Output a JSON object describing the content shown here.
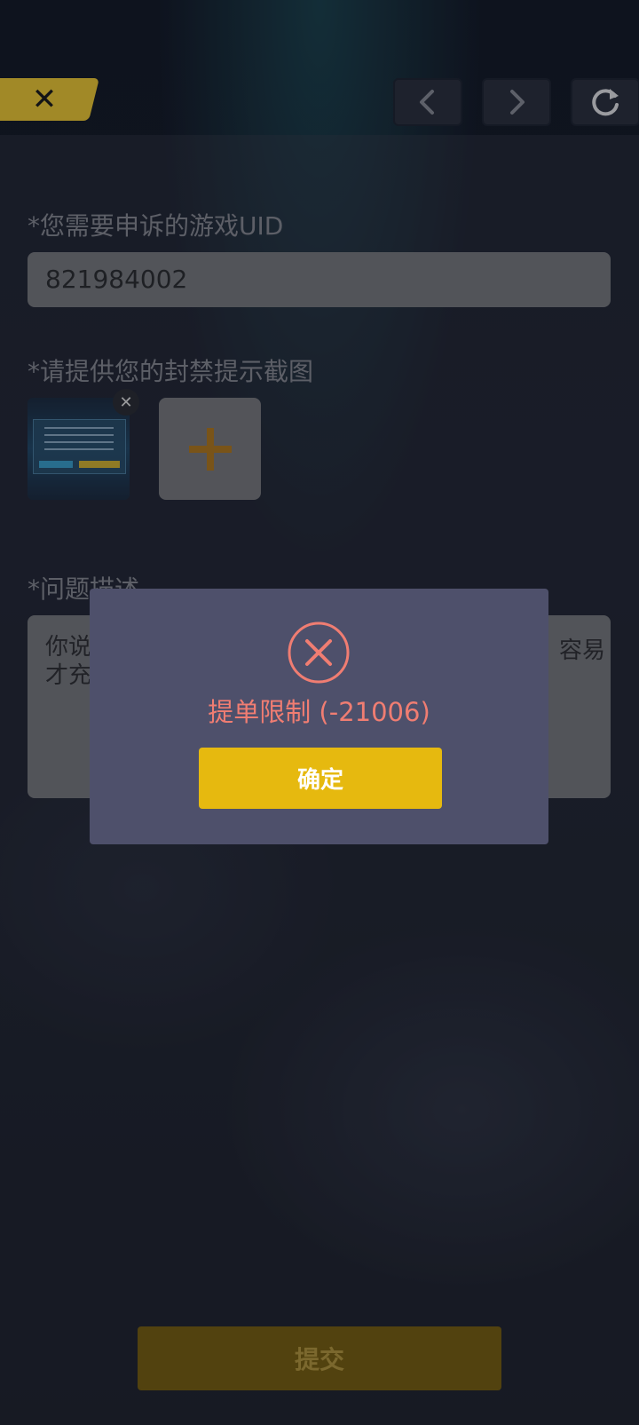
{
  "nav": {
    "close_icon": "close-icon",
    "back_icon": "chevron-left-icon",
    "forward_icon": "chevron-right-icon",
    "refresh_icon": "refresh-icon"
  },
  "form": {
    "uid_label": "*您需要申诉的游戏UID",
    "uid_value": "821984002",
    "screenshot_label": "*请提供您的封禁提示截图",
    "description_label": "*问题描述",
    "description_value": "你说",
    "description_second_line": "才充",
    "description_tail": "容易"
  },
  "dialog": {
    "error_message": "提单限制 (-21006)",
    "confirm_label": "确定"
  },
  "footer": {
    "submit_label": "提交"
  },
  "colors": {
    "accent_yellow": "#e6b90f",
    "error_red": "#f07d72",
    "dialog_bg": "#4e506b"
  }
}
